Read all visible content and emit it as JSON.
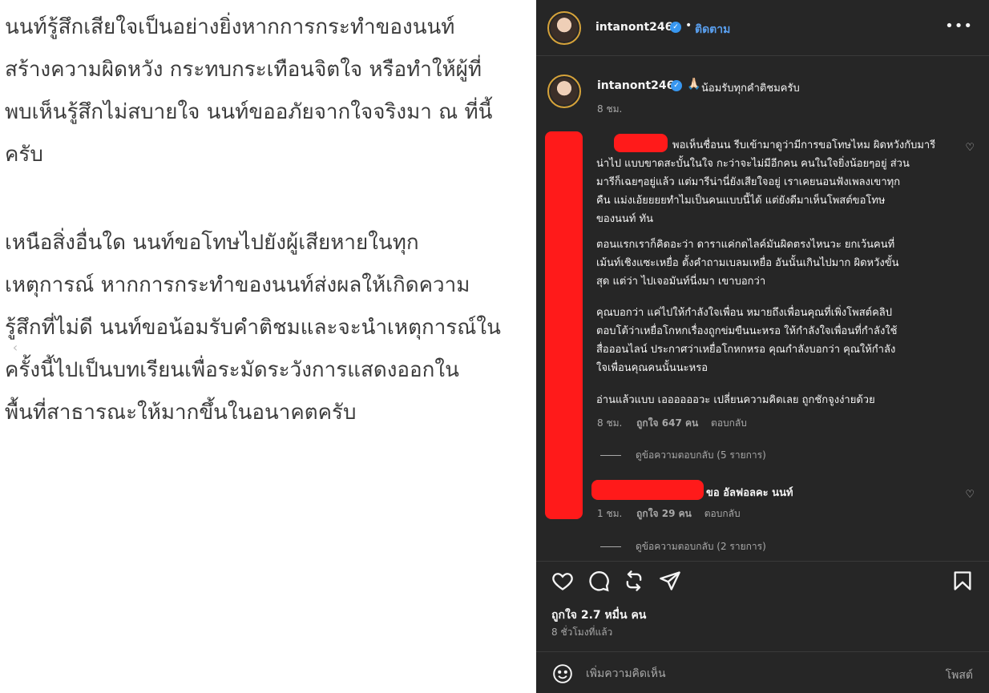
{
  "post_text": {
    "paragraph1": "นนท์รู้สึกเสียใจเป็นอย่างยิ่งหากการกระทำของนนท์\nสร้างความผิดหวัง กระทบกระเทือนจิตใจ หรือทำให้ผู้ที่\nพบเห็นรู้สึกไม่สบายใจ นนท์ขออภัยจากใจจริงมา ณ ที่นี้\nครับ",
    "paragraph2": "เหนือสิ่งอื่นใด นนท์ขอโทษไปยังผู้เสียหายในทุก\nเหตุการณ์ หากการกระทำของนนท์ส่งผลให้เกิดความ\nรู้สึกที่ไม่ดี นนท์ขอน้อมรับคำติชมและจะนำเหตุการณ์ใน\nครั้งนี้ไปเป็นบทเรียนเพื่อระมัดระวังการแสดงออกใน\nพื้นที่สาธารณะให้มากขึ้นในอนาคตครับ"
  },
  "header": {
    "username": "intanont246",
    "verified_mark": "✓",
    "separator": "•",
    "follow_label": "ติดตาม",
    "more_label": "•••"
  },
  "caption": {
    "username": "intanont246",
    "emoji": "🙏🏻",
    "text": "น้อมรับทุกคำติชมครับ",
    "time": "8 ชม."
  },
  "comments": [
    {
      "p1": "พอเห็นชื่อนน รีบเข้ามาดูว่ามีการขอโทษไหม ผิดหวังกับมารี\nน่าไป แบบขาดสะบั้นในใจ กะว่าจะไม่มีอีกคน คนในใจยิ่งน้อยๆอยู่ ส่วน\nมารีก็เฉยๆอยู่แล้ว แต่มารีน่านี่ยังเสียใจอยู่ เราเคยนอนฟังเพลงเขาทุก\nคืน แม่งเอ้ยยยยทำไมเป็นคนแบบนี้ได้ แต่ยังดีมาเห็นโพสต์ขอโทษ\nของนนท์ ทัน",
      "p2": "ตอนแรกเราก็คิดอะว่า ดาราแค่กดไลค์มันผิดตรงไหนวะ ยกเว้นคนที่\nเม้นท์เชิงแซะเหยื่อ ตั้งคำถามเบลมเหยื่อ อันนั้นเกินไปมาก ผิดหวังขั้น\nสุด แต่ว่า ไปเจอมันท์นี่งมา เขาบอกว่า",
      "p3": "คุณบอกว่า แค่ไปให้กำลังใจเพื่อน หมายถึงเพื่อนคุณที่เพิ่งโพสต์คลิป\nตอบโต้ว่าเหยื่อโกหกเรื่องถูกข่มขืนนะหรอ ให้กำลังใจเพื่อนที่กำลังใช้\nสื่อออนไลน์ ประกาศว่าเหยื่อโกหกหรอ คุณกำลังบอกว่า คุณให้กำลัง\nใจเพื่อนคุณคนนั้นนะหรอ",
      "p4": "อ่านแล้วแบบ เออออออวะ เปลี่ยนความคิดเลย ถูกชักจูงง่ายด้วย",
      "time": "8 ชม.",
      "likes": "ถูกใจ 647 คน",
      "reply": "ตอบกลับ",
      "view_replies": "ดูข้อความตอบกลับ (5 รายการ)"
    },
    {
      "text": "ขอ อัลฟอลคะ นนท์",
      "time": "1 ชม.",
      "likes": "ถูกใจ 29 คน",
      "reply": "ตอบกลับ",
      "view_replies": "ดูข้อความตอบกลับ (2 รายการ)"
    }
  ],
  "footer": {
    "likes": "ถูกใจ 2.7 หมื่น คน",
    "time_ago": "8 ชั่วโมงที่แล้ว",
    "add_comment_placeholder": "เพิ่มความคิดเห็น",
    "post_label": "โพสต์"
  },
  "nav": {
    "prev_label": "‹"
  },
  "colors": {
    "panel_bg": "#262626",
    "accent_blue": "#3897f0",
    "redaction": "#ff1a1a"
  }
}
